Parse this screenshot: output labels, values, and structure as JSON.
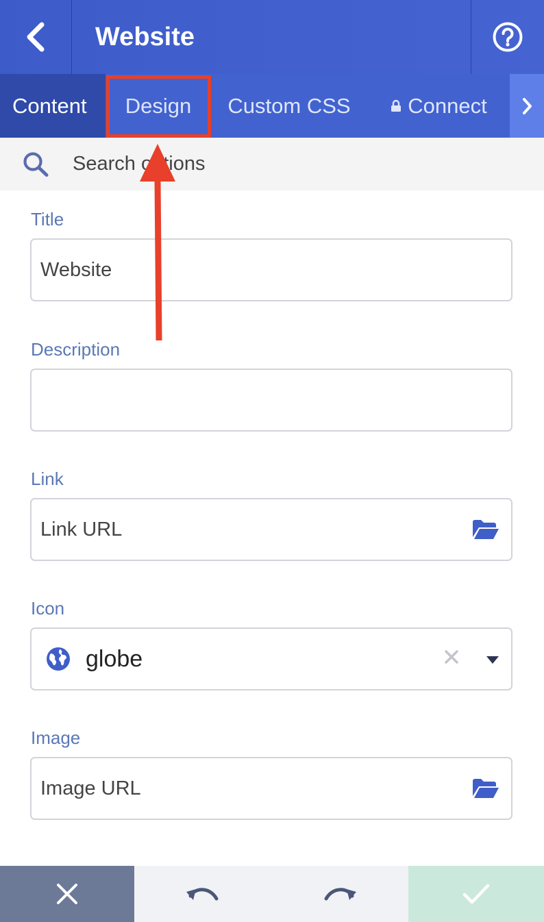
{
  "header": {
    "title": "Website",
    "back_icon": "chevron-left-icon",
    "help_icon": "question-circle-icon"
  },
  "tabs": [
    {
      "label": "Content",
      "active": true
    },
    {
      "label": "Design",
      "active": false
    },
    {
      "label": "Custom CSS",
      "active": false
    },
    {
      "label": "Connect",
      "active": false,
      "icon": "lock-icon"
    }
  ],
  "tabs_more_icon": "chevron-right-icon",
  "search": {
    "placeholder": "Search options"
  },
  "form": {
    "title": {
      "label": "Title",
      "value": "Website"
    },
    "description": {
      "label": "Description",
      "value": ""
    },
    "link": {
      "label": "Link",
      "placeholder": "Link URL"
    },
    "icon": {
      "label": "Icon",
      "value": "globe"
    },
    "image": {
      "label": "Image",
      "placeholder": "Image URL"
    }
  },
  "footer": {
    "cancel_icon": "close-icon",
    "undo_icon": "undo-icon",
    "redo_icon": "redo-icon",
    "save_icon": "check-icon"
  },
  "colors": {
    "header": "#3d5cc9",
    "tab_active": "#2f4aa8",
    "annotation": "#e8402a",
    "label": "#5b78b5",
    "cancel": "#6c7a98",
    "save": "#cbe8dc"
  }
}
